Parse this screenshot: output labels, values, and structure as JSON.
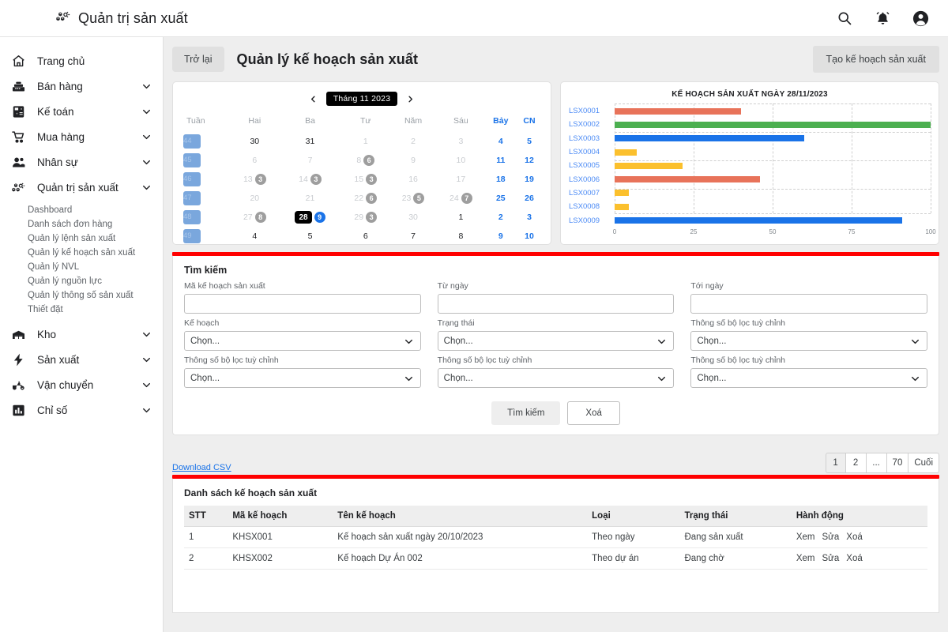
{
  "app": {
    "brand_title": "Quản trị sản xuất",
    "brand_icon": "boxes-icon",
    "actions": [
      {
        "name": "search-icon",
        "label": "Tìm kiếm"
      },
      {
        "name": "bell-icon",
        "label": "Thông báo"
      },
      {
        "name": "account-icon",
        "label": "Tài khoản"
      }
    ]
  },
  "sidebar": {
    "items": [
      {
        "label": "Trang chủ",
        "icon": "home-icon",
        "expandable": false
      },
      {
        "label": "Bán hàng",
        "icon": "cash-register-icon",
        "expandable": true
      },
      {
        "label": "Kế toán",
        "icon": "calculator-icon",
        "expandable": true
      },
      {
        "label": "Mua hàng",
        "icon": "cart-icon",
        "expandable": true
      },
      {
        "label": "Nhân sự",
        "icon": "people-icon",
        "expandable": true
      },
      {
        "label": "Quản trị sản xuất",
        "icon": "boxes-icon",
        "expandable": true,
        "expanded": true
      },
      {
        "label": "Kho",
        "icon": "warehouse-icon",
        "expandable": true
      },
      {
        "label": "Sản xuất",
        "icon": "bolt-icon",
        "expandable": true
      },
      {
        "label": "Vận chuyển",
        "icon": "scooter-icon",
        "expandable": true
      },
      {
        "label": "Chỉ số",
        "icon": "bar-chart-icon",
        "expandable": true
      }
    ],
    "submenu": [
      "Dashboard",
      "Danh sách đơn hàng",
      "Quản lý lệnh sản xuất",
      "Quản lý kế hoạch sản xuất",
      "Quản lý NVL",
      "Quản lý nguồn lực",
      "Quản lý thông số sản xuất",
      "Thiết đặt"
    ]
  },
  "page": {
    "back_label": "Trở lại",
    "title": "Quản lý kế hoạch sản xuất",
    "create_label": "Tạo kế hoạch sản xuất"
  },
  "calendar": {
    "month_label": "Tháng 11 2023",
    "prev_icon": "chevron-left-icon",
    "next_icon": "chevron-right-icon",
    "headers": [
      "Tuần",
      "Hai",
      "Ba",
      "Tư",
      "Năm",
      "Sáu",
      "Bảy",
      "CN"
    ],
    "weeks": [
      {
        "week": "44",
        "days": [
          {
            "d": "30",
            "t": "in"
          },
          {
            "d": "31",
            "t": "in"
          },
          {
            "d": "1",
            "t": "out"
          },
          {
            "d": "2",
            "t": "out"
          },
          {
            "d": "3",
            "t": "out"
          },
          {
            "d": "4",
            "t": "wknd"
          },
          {
            "d": "5",
            "t": "wknd"
          }
        ]
      },
      {
        "week": "45",
        "days": [
          {
            "d": "6",
            "t": "out"
          },
          {
            "d": "7",
            "t": "out"
          },
          {
            "d": "8",
            "t": "out",
            "badge": "6"
          },
          {
            "d": "9",
            "t": "out"
          },
          {
            "d": "10",
            "t": "out"
          },
          {
            "d": "11",
            "t": "wknd"
          },
          {
            "d": "12",
            "t": "wknd"
          }
        ]
      },
      {
        "week": "46",
        "days": [
          {
            "d": "13",
            "t": "out",
            "badge": "3"
          },
          {
            "d": "14",
            "t": "out",
            "badge": "3"
          },
          {
            "d": "15",
            "t": "out",
            "badge": "3"
          },
          {
            "d": "16",
            "t": "out"
          },
          {
            "d": "17",
            "t": "out"
          },
          {
            "d": "18",
            "t": "wknd"
          },
          {
            "d": "19",
            "t": "wknd"
          }
        ]
      },
      {
        "week": "47",
        "days": [
          {
            "d": "20",
            "t": "out"
          },
          {
            "d": "21",
            "t": "out"
          },
          {
            "d": "22",
            "t": "out",
            "badge": "6"
          },
          {
            "d": "23",
            "t": "out",
            "badge": "5"
          },
          {
            "d": "24",
            "t": "out",
            "badge": "7"
          },
          {
            "d": "25",
            "t": "wknd"
          },
          {
            "d": "26",
            "t": "wknd"
          }
        ]
      },
      {
        "week": "48",
        "days": [
          {
            "d": "27",
            "t": "out",
            "badge": "8"
          },
          {
            "d": "28",
            "t": "today",
            "badge": "9",
            "badge_hot": true
          },
          {
            "d": "29",
            "t": "out",
            "badge": "3"
          },
          {
            "d": "30",
            "t": "out"
          },
          {
            "d": "1",
            "t": "in"
          },
          {
            "d": "2",
            "t": "wknd"
          },
          {
            "d": "3",
            "t": "wknd"
          }
        ]
      },
      {
        "week": "49",
        "days": [
          {
            "d": "4",
            "t": "in"
          },
          {
            "d": "5",
            "t": "in"
          },
          {
            "d": "6",
            "t": "in"
          },
          {
            "d": "7",
            "t": "in"
          },
          {
            "d": "8",
            "t": "in"
          },
          {
            "d": "9",
            "t": "wknd"
          },
          {
            "d": "10",
            "t": "wknd"
          }
        ]
      }
    ]
  },
  "chart_data": {
    "type": "bar",
    "orientation": "horizontal",
    "title": "KẾ HOẠCH SẢN XUẤT NGÀY 28/11/2023",
    "categories": [
      "LSX0001",
      "LSX0002",
      "LSX0003",
      "LSX0004",
      "LSX0005",
      "LSX0006",
      "LSX0007",
      "LSX0008",
      "LSX0009"
    ],
    "values": [
      40,
      100,
      60,
      7,
      21.5,
      46,
      4.5,
      4.5,
      91
    ],
    "colors": [
      "#e8735a",
      "#4caf50",
      "#1a73e8",
      "#fbc02d",
      "#fbc02d",
      "#e8735a",
      "#fbc02d",
      "#fbc02d",
      "#1a73e8"
    ],
    "xlabel": "",
    "ylabel": "",
    "xlim": [
      0,
      100
    ],
    "xticks": [
      0,
      25,
      50,
      75,
      100
    ],
    "grid": true,
    "legend": false
  },
  "search": {
    "heading": "Tìm kiếm",
    "fields": [
      {
        "label": "Mã kế hoạch sản xuất",
        "type": "text",
        "value": "",
        "name": "plan-code-field"
      },
      {
        "label": "Từ ngày",
        "type": "text",
        "value": "",
        "name": "from-date-field"
      },
      {
        "label": "Tới ngày",
        "type": "text",
        "value": "",
        "name": "to-date-field"
      },
      {
        "label": "Kế hoạch",
        "type": "select",
        "value": "Chọn...",
        "name": "plan-select"
      },
      {
        "label": "Trạng thái",
        "type": "select",
        "value": "Chọn...",
        "name": "status-select"
      },
      {
        "label": "Thông số bộ lọc tuỳ chỉnh",
        "type": "select",
        "value": "Chọn...",
        "name": "custom-filter-select-1"
      },
      {
        "label": "Thông số bộ lọc tuỳ chỉnh",
        "type": "select",
        "value": "Chọn...",
        "name": "custom-filter-select-2"
      },
      {
        "label": "Thông số bộ lọc tuỳ chỉnh",
        "type": "select",
        "value": "Chọn...",
        "name": "custom-filter-select-3"
      },
      {
        "label": "Thông số bộ lọc tuỳ chỉnh",
        "type": "select",
        "value": "Chọn...",
        "name": "custom-filter-select-4"
      }
    ],
    "search_button": "Tìm kiếm",
    "clear_button": "Xoá"
  },
  "toolbar": {
    "download_csv": "Download CSV",
    "pagination": [
      "1",
      "2",
      "...",
      "70",
      "Cuối"
    ]
  },
  "results": {
    "heading": "Danh sách kế hoạch sản xuất",
    "columns": [
      "STT",
      "Mã kế hoạch",
      "Tên kế hoạch",
      "Loại",
      "Trạng thái",
      "Hành động"
    ],
    "rows": [
      {
        "stt": "1",
        "code": "KHSX001",
        "name": "Kế hoạch sản xuất ngày 20/10/2023",
        "type": "Theo ngày",
        "status": "Đang sản xuất",
        "actions": [
          "Xem",
          "Sửa",
          "Xoá"
        ]
      },
      {
        "stt": "2",
        "code": "KHSX002",
        "name": "Kế hoạch Dự Án 002",
        "type": "Theo dự án",
        "status": "Đang chờ",
        "actions": [
          "Xem",
          "Sửa",
          "Xoá"
        ]
      }
    ]
  },
  "theme": {
    "accent_blue": "#1a73e8",
    "divider_red": "#ff0000",
    "page_bg": "#eeeeee"
  }
}
